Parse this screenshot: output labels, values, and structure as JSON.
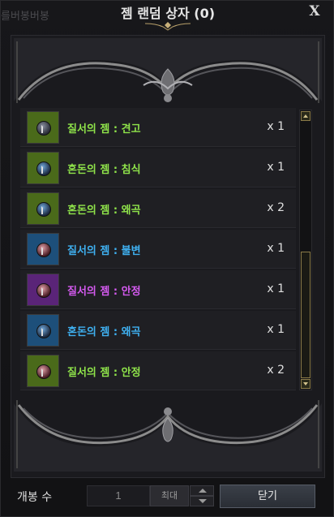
{
  "window": {
    "title": "젬 랜덤 상자 (0)",
    "bg_text": "를버봉버봉",
    "close_glyph": "X"
  },
  "items": [
    {
      "name": "질서의 젬 : 견고",
      "qty": "x 1",
      "name_color": "#8fe34a",
      "frame_color": "#4a6a1a",
      "icon": "gem-order-icon"
    },
    {
      "name": "혼돈의 젬 : 침식",
      "qty": "x 1",
      "name_color": "#8fe34a",
      "frame_color": "#4a6a1a",
      "icon": "gem-chaos-icon"
    },
    {
      "name": "혼돈의 젬 : 왜곡",
      "qty": "x 2",
      "name_color": "#8fe34a",
      "frame_color": "#4a6a1a",
      "icon": "gem-chaos-icon"
    },
    {
      "name": "질서의 젬 : 불변",
      "qty": "x 1",
      "name_color": "#3fb0f0",
      "frame_color": "#1d4f7a",
      "icon": "gem-order-icon"
    },
    {
      "name": "질서의 젬 : 안정",
      "qty": "x 1",
      "name_color": "#d45aef",
      "frame_color": "#5a2478",
      "icon": "gem-order-icon"
    },
    {
      "name": "혼돈의 젬 : 왜곡",
      "qty": "x 1",
      "name_color": "#3fb0f0",
      "frame_color": "#1d4f7a",
      "icon": "gem-chaos-icon"
    },
    {
      "name": "질서의 젬 : 안정",
      "qty": "x 2",
      "name_color": "#8fe34a",
      "frame_color": "#4a6a1a",
      "icon": "gem-order-icon"
    }
  ],
  "footer": {
    "open_count_label": "개봉 수",
    "quantity_value": "1",
    "max_label": "최대",
    "close_label": "닫기"
  }
}
